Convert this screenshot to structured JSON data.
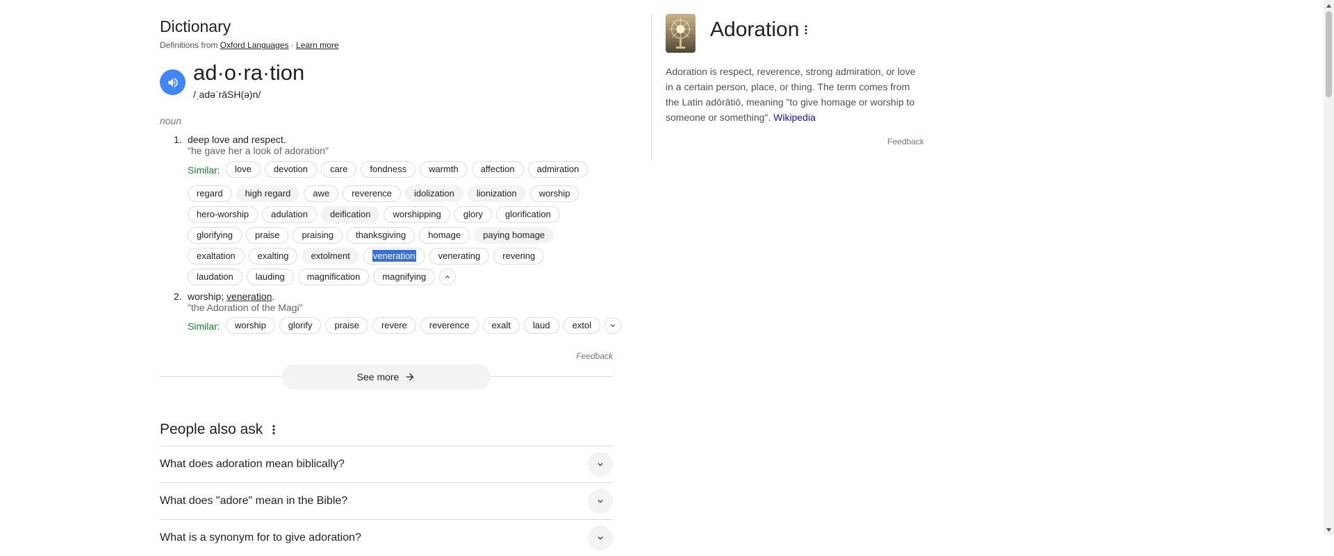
{
  "dictionary": {
    "title": "Dictionary",
    "source_prefix": "Definitions from ",
    "source_link": "Oxford Languages",
    "source_sep": " · ",
    "learn_more": "Learn more",
    "headword": "ad·o·ra·tion",
    "phonetic": "/ˌadəˈrāSH(ə)n/",
    "part_of_speech": "noun",
    "similar_label": "Similar:",
    "senses": [
      {
        "number": "1.",
        "definition": "deep love and respect.",
        "example": "\"he gave her a look of adoration\"",
        "similar_rows": [
          [
            "love",
            "devotion",
            "care",
            "fondness",
            "warmth",
            "affection",
            "admiration"
          ],
          [
            "regard",
            "high regard",
            "awe",
            "reverence",
            "idolization",
            "lionization",
            "worship"
          ],
          [
            "hero-worship",
            "adulation",
            "deification",
            "worshipping",
            "glory",
            "glorification"
          ],
          [
            "glorifying",
            "praise",
            "praising",
            "thanksgiving",
            "homage",
            "paying homage"
          ],
          [
            "exaltation",
            "exalting",
            "extolment",
            "veneration",
            "venerating",
            "revering"
          ],
          [
            "laudation",
            "lauding",
            "magnification",
            "magnifying"
          ]
        ]
      },
      {
        "number": "2.",
        "definition": "worship; ",
        "definition_link": "veneration",
        "definition_end": ".",
        "example": "\"the Adoration of the Magi\"",
        "similar_rows": [
          [
            "worship",
            "glorify",
            "praise",
            "revere",
            "reverence",
            "exalt",
            "laud",
            "extol"
          ]
        ]
      }
    ],
    "feedback": "Feedback",
    "see_more": "See more"
  },
  "people_also_ask": {
    "title": "People also ask",
    "questions": [
      "What does adoration mean biblically?",
      "What does \"adore\" mean in the Bible?",
      "What is a synonym for to give adoration?"
    ]
  },
  "knowledge_panel": {
    "title": "Adoration",
    "description": "Adoration is respect, reverence, strong admiration, or love in a certain person, place, or thing. The term comes from the Latin adōrātiō, meaning \"to give homage or worship to someone or something\". ",
    "source_link": "Wikipedia",
    "feedback": "Feedback"
  }
}
